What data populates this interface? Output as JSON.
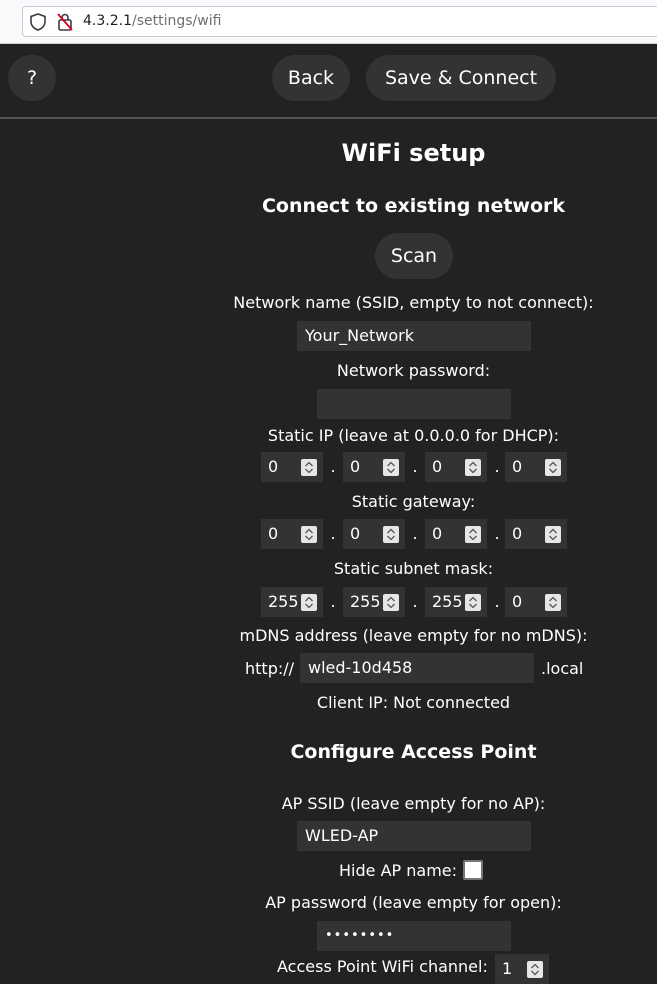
{
  "browser": {
    "url_host": "4.3.2.1",
    "url_path": "/settings/wifi"
  },
  "nav": {
    "help_label": "?",
    "back_label": "Back",
    "save_label": "Save & Connect"
  },
  "page": {
    "title": "WiFi setup"
  },
  "connect": {
    "heading": "Connect to existing network",
    "scan_label": "Scan",
    "ssid_label": "Network name (SSID, empty to not connect):",
    "ssid_value": "Your_Network",
    "password_label": "Network password:",
    "password_value": "",
    "static_ip_label": "Static IP (leave at 0.0.0.0 for DHCP):",
    "static_ip": [
      "0",
      "0",
      "0",
      "0"
    ],
    "gateway_label": "Static gateway:",
    "gateway": [
      "0",
      "0",
      "0",
      "0"
    ],
    "subnet_label": "Static subnet mask:",
    "subnet": [
      "255",
      "255",
      "255",
      "0"
    ],
    "mdns_label": "mDNS address (leave empty for no mDNS):",
    "mdns_prefix": "http://",
    "mdns_value": "wled-10d458",
    "mdns_suffix": ".local",
    "client_ip": "Client IP: Not connected"
  },
  "ap": {
    "heading": "Configure Access Point",
    "ssid_label": "AP SSID (leave empty for no AP):",
    "ssid_value": "WLED-AP",
    "hide_label": "Hide AP name:",
    "hide_checked": false,
    "password_label": "AP password (leave empty for open):",
    "password_value": "••••••••",
    "channel_label": "Access Point WiFi channel:",
    "channel_value": "1"
  },
  "colors": {
    "background": "#222222",
    "control": "#333333",
    "text": "#ffffff"
  }
}
